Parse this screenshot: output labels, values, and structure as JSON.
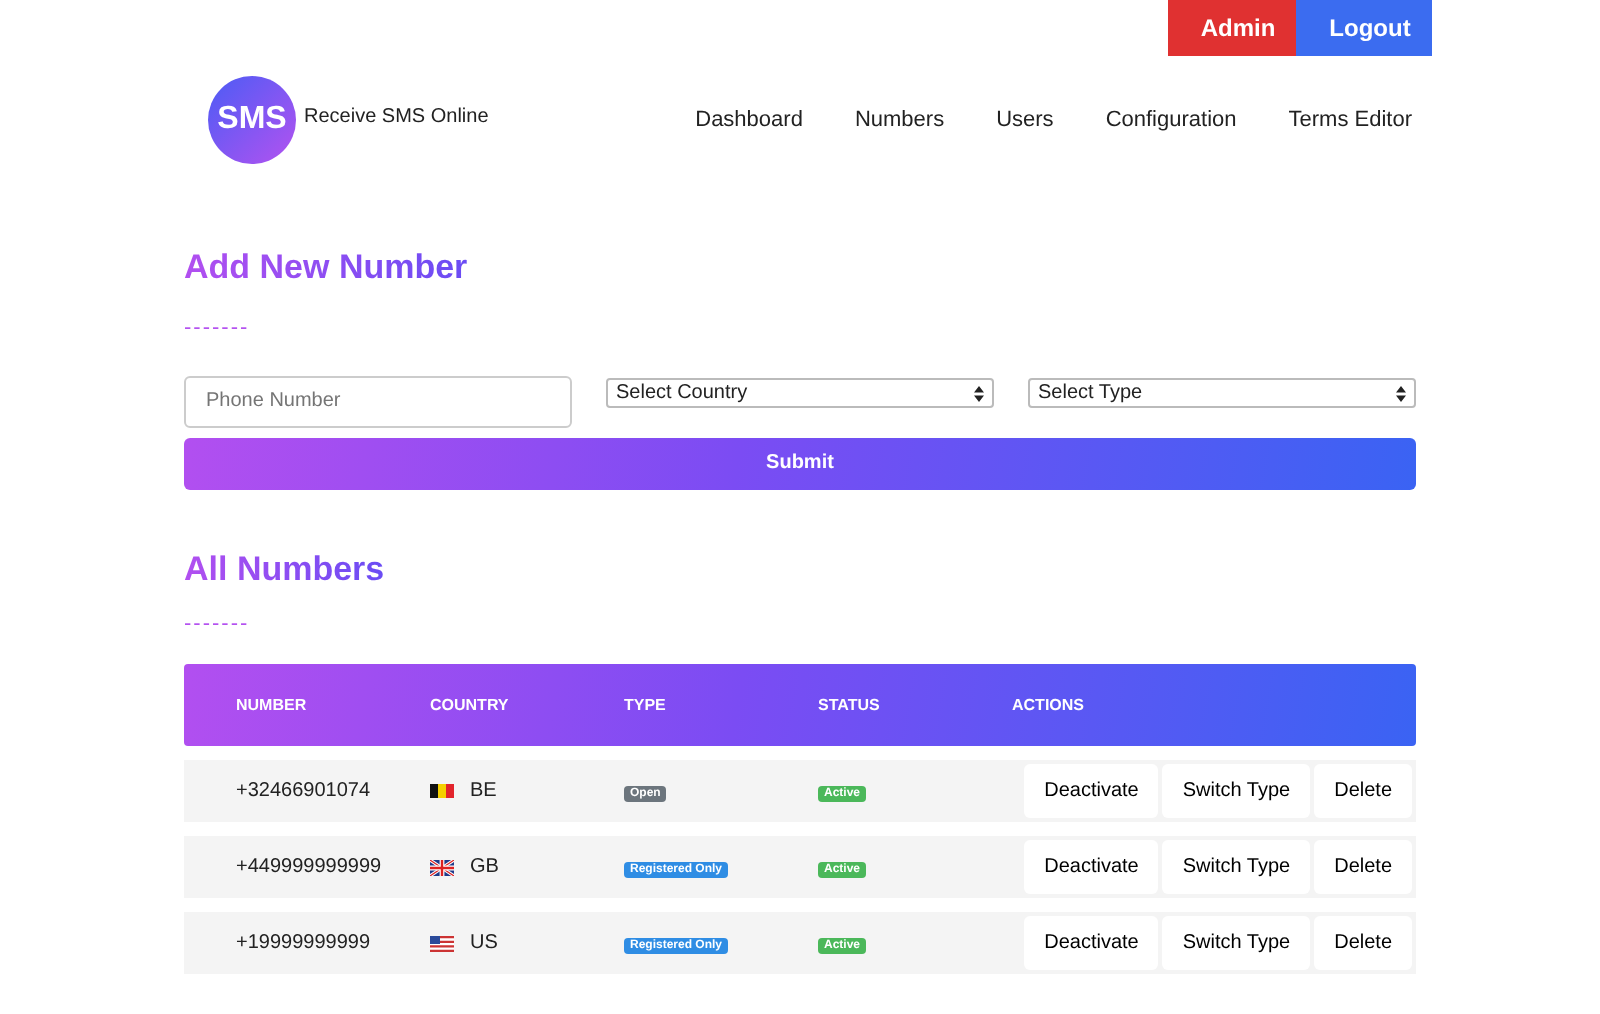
{
  "top_buttons": [
    {
      "label": "Admin",
      "kind": "admin"
    },
    {
      "label": "Logout",
      "kind": "logout"
    }
  ],
  "logo": {
    "badge": "SMS",
    "title": "Receive SMS Online"
  },
  "nav": [
    {
      "label": "Dashboard"
    },
    {
      "label": "Numbers"
    },
    {
      "label": "Users"
    },
    {
      "label": "Configuration"
    },
    {
      "label": "Terms Editor"
    }
  ],
  "add_form": {
    "title": "Add New Number",
    "divider": "-------",
    "phone": {
      "placeholder": "Phone Number"
    },
    "country_select": "Select Country",
    "type_select": "Select Type",
    "submit": "Submit"
  },
  "all_numbers": {
    "title": "All Numbers",
    "divider": "-------",
    "table": {
      "columns": [
        "NUMBER",
        "COUNTRY",
        "TYPE",
        "STATUS",
        "ACTIONS"
      ],
      "rows": [
        {
          "number": "+32466901074",
          "country": "BE",
          "type": {
            "text": "Open",
            "kind": "open"
          },
          "status": {
            "text": "Active",
            "kind": "active"
          },
          "actions": [
            "Deactivate",
            "Switch Type",
            "Delete"
          ]
        },
        {
          "number": "+449999999999",
          "country": "GB",
          "type": {
            "text": "Registered Only",
            "kind": "registered"
          },
          "status": {
            "text": "Active",
            "kind": "active"
          },
          "actions": [
            "Deactivate",
            "Switch Type",
            "Delete"
          ]
        },
        {
          "number": "+19999999999",
          "country": "US",
          "type": {
            "text": "Registered Only",
            "kind": "registered"
          },
          "status": {
            "text": "Active",
            "kind": "active"
          },
          "actions": [
            "Deactivate",
            "Switch Type",
            "Delete"
          ]
        }
      ]
    }
  }
}
